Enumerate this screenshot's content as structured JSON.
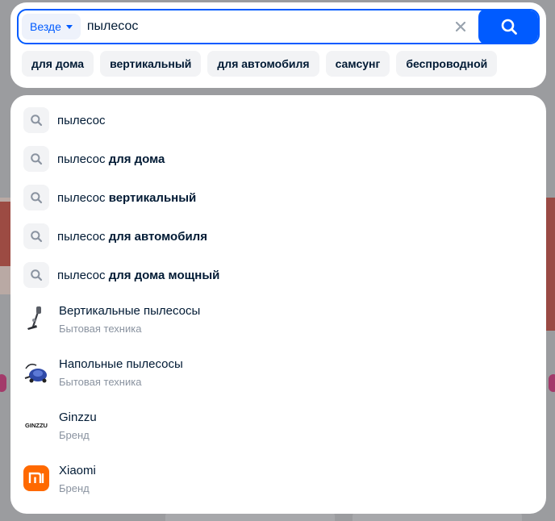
{
  "search": {
    "scope_label": "Везде",
    "query": "пылесос",
    "clear_label": "×"
  },
  "chips": [
    "для дома",
    "вертикальный",
    "для автомобиля",
    "самсунг",
    "беспроводной"
  ],
  "query_suggestions": [
    {
      "base": "пылесос",
      "extra": ""
    },
    {
      "base": "пылесос ",
      "extra": "для дома"
    },
    {
      "base": "пылесос ",
      "extra": "вертикальный"
    },
    {
      "base": "пылесос ",
      "extra": "для автомобиля"
    },
    {
      "base": "пылесос ",
      "extra": "для дома мощный"
    }
  ],
  "category_suggestions": [
    {
      "title": "Вертикальные пылесосы",
      "subtitle": "Бытовая техника",
      "icon": "stick-vacuum-icon"
    },
    {
      "title": "Напольные пылесосы",
      "subtitle": "Бытовая техника",
      "icon": "canister-vacuum-icon"
    },
    {
      "title": "Ginzzu",
      "subtitle": "Бренд",
      "icon": "ginzzu-logo",
      "logo_text": "GINZZU"
    },
    {
      "title": "Xiaomi",
      "subtitle": "Бренд",
      "icon": "xiaomi-logo",
      "logo_text": "mi"
    }
  ],
  "colors": {
    "accent": "#005bff",
    "text": "#001a34",
    "muted": "#8a93a0",
    "xiaomi": "#ff6900"
  }
}
